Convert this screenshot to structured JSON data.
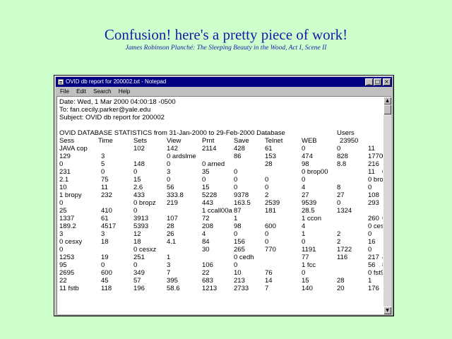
{
  "slide": {
    "title": "Confusion! here's a pretty piece of work!",
    "subtitle": "James Robinson Planché: The Sleeping Beauty in the Wood, Act I, Scene II"
  },
  "window": {
    "title": "OVID db report for 200002.txt - Notepad",
    "minimize_icon": "_",
    "maximize_icon": "□",
    "close_icon": "×"
  },
  "menu": [
    "File",
    "Edit",
    "Search",
    "Help"
  ],
  "email_header": [
    "Date: Wed, 1 Mar 2000 04:00:18 -0500",
    "To: fan.cecily.parker@yale.edu",
    "Subject: OVID db report for 200002"
  ],
  "report": {
    "banner": [
      "OVID DATABASE STATISTICS from  31-Jan-2000  to  29-Feb-2000 Database",
      "Users"
    ],
    "columns": [
      "Sess",
      "Time",
      "Sets",
      "View",
      "Prnt",
      "Save",
      "Telnet",
      "WEB",
      "23950"
    ],
    "rows": [
      [
        "JAVA cop",
        "",
        "102",
        "142",
        "2114",
        "428",
        "61",
        "0",
        "0",
        "11"
      ],
      [
        "129",
        "3",
        "",
        "0 ardslme",
        "",
        "86",
        "153",
        "474",
        "828",
        "1770",
        "0"
      ],
      [
        "0",
        "5",
        "148",
        "0",
        "0 arned",
        "",
        "28",
        "98",
        "8.8",
        "216"
      ],
      [
        "231",
        "0",
        "0",
        "3",
        "35",
        "0",
        "",
        "0 brop00",
        "",
        "11",
        "0"
      ],
      [
        "2.1",
        "75",
        "15",
        "0",
        "0",
        "0",
        "0",
        "0",
        "",
        "0 brop99"
      ],
      [
        "10",
        "11",
        "2.6",
        "56",
        "15",
        "0",
        "0",
        "4",
        "8",
        "0"
      ],
      [
        "1 bropy",
        "232",
        "433",
        "333.8",
        "5228",
        "9378",
        "2",
        "27",
        "27",
        "108"
      ],
      [
        "0",
        "",
        "0 bropz",
        "219",
        "443",
        "163.5",
        "2539",
        "9539",
        "0",
        "293"
      ],
      [
        "25",
        "410",
        "0",
        "",
        "1 ccall00a",
        "87",
        "181",
        "28.5",
        "1324",
        ""
      ],
      [
        "1337",
        "61",
        "3913",
        "107",
        "72",
        "1",
        "",
        "1 ccon",
        "",
        "260",
        "602"
      ],
      [
        "189.2",
        "4517",
        "5393",
        "28",
        "208",
        "98",
        "600",
        "4",
        "",
        "0 cesx99"
      ],
      [
        "3",
        "3",
        "12",
        "26",
        "4",
        "0",
        "0",
        "1",
        "2",
        "0"
      ],
      [
        "0 cesxy",
        "18",
        "18",
        "4.1",
        "84",
        "156",
        "0",
        "0",
        "2",
        "16"
      ],
      [
        "0",
        "",
        "0 cesxz",
        "",
        "30",
        "265",
        "770",
        "1191",
        "1722",
        "0"
      ],
      [
        "1253",
        "19",
        "251",
        "1",
        "",
        "0 cedh",
        "",
        "77",
        "116",
        "217",
        "400"
      ],
      [
        "95",
        "0",
        "0",
        "3",
        "106",
        "0",
        "",
        "1 fcc",
        "",
        "56",
        "86"
      ],
      [
        "2695",
        "600",
        "349",
        "7",
        "22",
        "10",
        "76",
        "0",
        "",
        "0 fst98"
      ],
      [
        "22",
        "45",
        "57",
        "395",
        "683",
        "213",
        "14",
        "15",
        "28",
        "1"
      ],
      [
        "11 fstb",
        "118",
        "196",
        "58.6",
        "1213",
        "2733",
        "7",
        "140",
        "20",
        "176"
      ]
    ]
  }
}
